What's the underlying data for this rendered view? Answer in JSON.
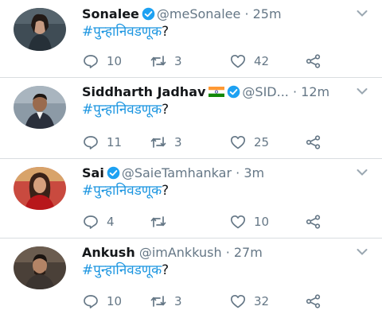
{
  "colors": {
    "link": "#1b95e0",
    "muted": "#657786",
    "verified": "#1da1f2",
    "divider": "#d9dde0"
  },
  "icons": {
    "reply": "reply-icon",
    "retweet": "retweet-icon",
    "like": "heart-icon",
    "share": "share-icon",
    "verified": "verified-badge-icon",
    "more": "chevron-down-icon",
    "flag": "india-flag-icon"
  },
  "tweets": [
    {
      "name": "Sonalee",
      "handle": "@meSonalee",
      "separator": "·",
      "time": "25m",
      "hashtag": "#पुन्हानिवडणूक",
      "suffix": "?",
      "replies": "10",
      "retweets": "3",
      "likes": "42"
    },
    {
      "name": "Siddharth Jadhav",
      "handle": "@SID...",
      "separator": "·",
      "time": "12m",
      "hashtag": "#पुन्हानिवडणूक",
      "suffix": "?",
      "replies": "11",
      "retweets": "3",
      "likes": "25"
    },
    {
      "name": "Sai",
      "handle": "@SaieTamhankar",
      "separator": "·",
      "time": "3m",
      "hashtag": "#पुन्हानिवडणूक",
      "suffix": "?",
      "replies": "4",
      "retweets": "",
      "likes": "10"
    },
    {
      "name": "Ankush",
      "handle": "@imAnkkush",
      "separator": "·",
      "time": "27m",
      "hashtag": "#पुन्हानिवडणूक",
      "suffix": "?",
      "replies": "10",
      "retweets": "3",
      "likes": "32"
    }
  ]
}
